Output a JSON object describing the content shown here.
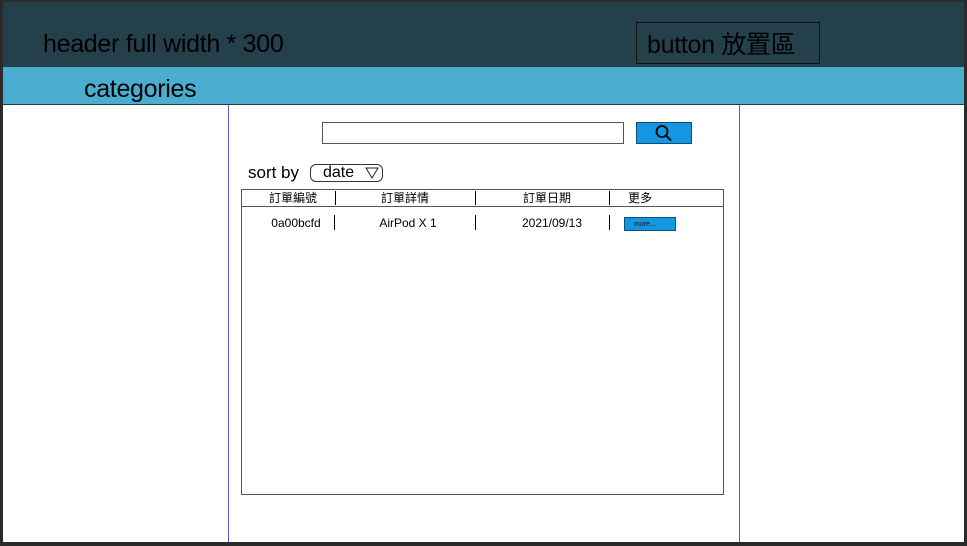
{
  "header": {
    "text": "header   full width * 300",
    "button_label": "button 放置區"
  },
  "categories_bar": {
    "label": "categories"
  },
  "search": {
    "value": "",
    "button_icon": "search-icon"
  },
  "sort": {
    "label": "sort by",
    "selected": "date",
    "arrow_icon": "triangle-down-icon"
  },
  "table": {
    "columns": [
      "訂單編號",
      "訂單詳情",
      "訂單日期",
      "更多"
    ],
    "rows": [
      {
        "order_id": "0a00bcfd",
        "details": "AirPod X 1",
        "date": "2021/09/13",
        "more_label": "more..."
      }
    ]
  },
  "colors": {
    "header_bg": "#23404b",
    "category_bg": "#4aacce",
    "button_blue": "#1497e0",
    "content_border": "#5a5ad8"
  }
}
